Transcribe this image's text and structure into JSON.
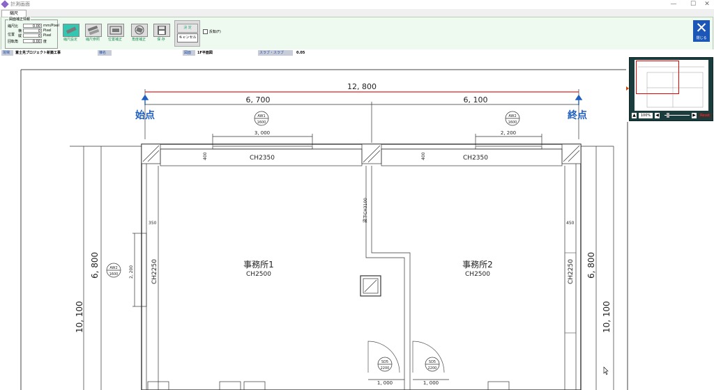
{
  "window": {
    "title": "計測画面",
    "min_icon": "minimize-icon",
    "max_icon": "maximize-icon",
    "close_icon": "close-icon"
  },
  "tabs": [
    "縮尺"
  ],
  "panel": {
    "title": "図面補正情報",
    "scale_label": "縮尺比",
    "scale_value": "0.00",
    "scale_unit": "mm/Pixel",
    "position_label": "位置",
    "h_label": "横",
    "h_value": "0",
    "v_label": "縦",
    "v_value": "0",
    "pixel_unit": "Pixel",
    "rotation_label": "回転角",
    "rotation_value": "0.00",
    "degree_unit": "度"
  },
  "tools": [
    {
      "label": "縮尺設定",
      "icon": "ruler-icon",
      "selected": true
    },
    {
      "label": "縮尺参照",
      "icon": "ruler-ref-icon",
      "selected": false
    },
    {
      "label": "位置補正",
      "icon": "position-icon",
      "selected": false
    },
    {
      "label": "角度補正",
      "icon": "rotate-icon",
      "selected": false
    },
    {
      "label": "保 存",
      "icon": "floppy-icon",
      "selected": false
    }
  ],
  "buttons": {
    "decide": "決 定",
    "cancel": "キャンセル"
  },
  "checkbox": {
    "label": "反転(F)"
  },
  "close_button": {
    "label": "閉じる"
  },
  "info": {
    "site_label": "現場",
    "site_value": "富士見プロジェクト新築工事",
    "struct_label": "棟名",
    "struct_value": "",
    "drawing_label": "図面",
    "drawing_value": "1F平面図",
    "scale_label": "スラブ・スラブ",
    "scale_value": "0.05"
  },
  "drawing": {
    "total": "12, 800",
    "left_span": "6, 700",
    "right_span": "6, 100",
    "start": "始点",
    "end": "終点",
    "aw1": "AW1",
    "aw1_size": "1600",
    "aw2": "AW2",
    "aw2_size": "1600",
    "aw2_side": "AW2",
    "aw2_side_size": "1600",
    "dim_3000": "3, 000",
    "dim_2200_top": "2, 200",
    "dim_2200_side": "2, 200",
    "ch2350_left": "CH2350",
    "ch2350_right": "CH2350",
    "d400_left": "400",
    "d400_right": "400",
    "d350": "350",
    "d450": "450",
    "ch3100": "梁下CH3100",
    "ch2250_left": "CH2250",
    "ch2250_right": "CH2250",
    "room1": "事務所1",
    "room1_ch": "CH2500",
    "room2": "事務所2",
    "room2_ch": "CH2500",
    "v6800_left": "6, 800",
    "v6800_right": "6, 800",
    "v10100_left": "10, 100",
    "v10100_right": "10, 100",
    "sd5a": "SD5",
    "sd5a_size": "2200",
    "sd5b": "SD5",
    "sd5b_size": "2200",
    "door_dim_a": "1, 000",
    "door_dim_b": "1, 000"
  },
  "minimap": {
    "zoom": "100%",
    "reset": "Reset"
  },
  "colors": {
    "accent": "#1c57b8",
    "measure_line": "#e02020",
    "label_blue": "#1f5fbf",
    "ribbon_bg": "#eef9ef"
  }
}
